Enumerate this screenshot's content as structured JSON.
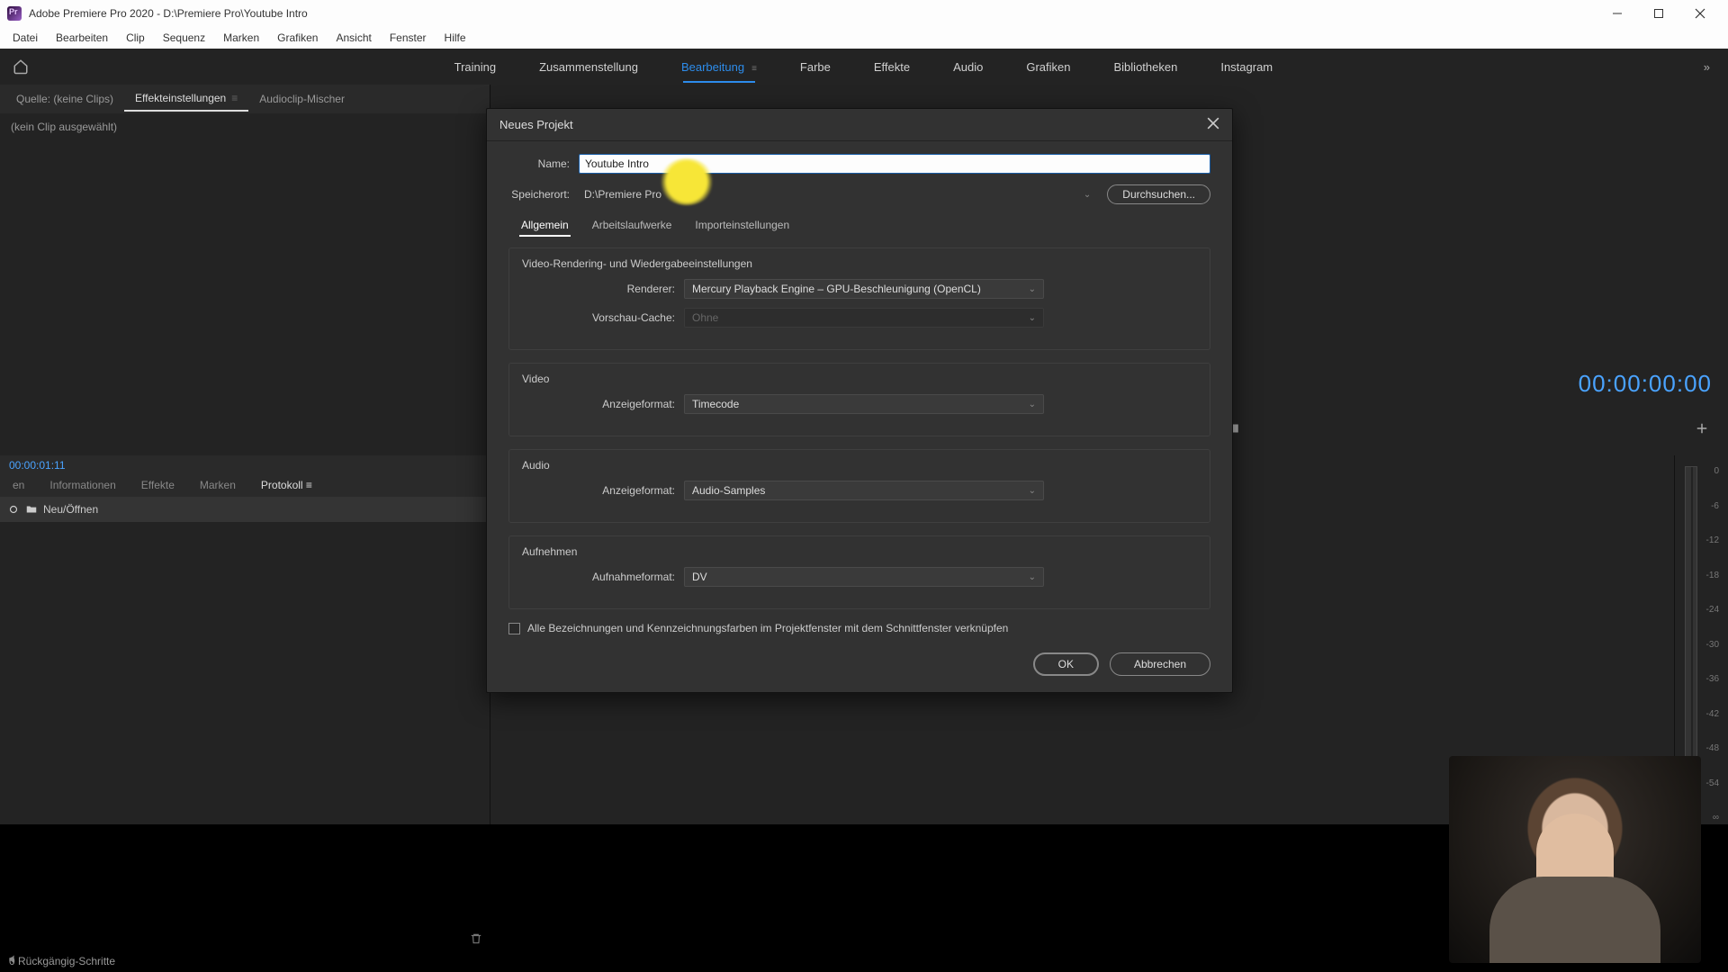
{
  "titlebar": {
    "title": "Adobe Premiere Pro 2020 - D:\\Premiere Pro\\Youtube Intro"
  },
  "menubar": {
    "items": [
      "Datei",
      "Bearbeiten",
      "Clip",
      "Sequenz",
      "Marken",
      "Grafiken",
      "Ansicht",
      "Fenster",
      "Hilfe"
    ]
  },
  "workspaces": {
    "items": [
      "Training",
      "Zusammenstellung",
      "Bearbeitung",
      "Farbe",
      "Effekte",
      "Audio",
      "Grafiken",
      "Bibliotheken",
      "Instagram"
    ],
    "active_index": 2,
    "overflow": "»"
  },
  "source_panel": {
    "tabs": [
      "Quelle: (keine Clips)",
      "Effekteinstellungen",
      "Audioclip-Mischer"
    ],
    "active_index": 1,
    "no_clip": "(kein Clip ausgewählt)"
  },
  "program_panel": {
    "timecode": "00:00:00:00"
  },
  "project_panel": {
    "timecode": "00:00:01:11",
    "tabs": [
      "en",
      "Informationen",
      "Effekte",
      "Marken",
      "Protokoll"
    ],
    "active_index": 4,
    "bin": "Neu/Öffnen"
  },
  "statusbar": {
    "undo": "0 Rückgängig-Schritte"
  },
  "meter": {
    "marks": [
      "0",
      "-6",
      "-12",
      "-18",
      "-24",
      "-30",
      "-36",
      "-42",
      "-48",
      "-54",
      "∞"
    ]
  },
  "dialog": {
    "title": "Neues Projekt",
    "name_label": "Name:",
    "name_value": "Youtube Intro",
    "location_label": "Speicherort:",
    "location_value": "D:\\Premiere Pro",
    "browse": "Durchsuchen...",
    "tabs": [
      "Allgemein",
      "Arbeitslaufwerke",
      "Importeinstellungen"
    ],
    "active_tab": 0,
    "groups": {
      "render": {
        "title": "Video-Rendering- und Wiedergabeeinstellungen",
        "renderer_label": "Renderer:",
        "renderer_value": "Mercury Playback Engine – GPU-Beschleunigung (OpenCL)",
        "cache_label": "Vorschau-Cache:",
        "cache_value": "Ohne"
      },
      "video": {
        "title": "Video",
        "format_label": "Anzeigeformat:",
        "format_value": "Timecode"
      },
      "audio": {
        "title": "Audio",
        "format_label": "Anzeigeformat:",
        "format_value": "Audio-Samples"
      },
      "capture": {
        "title": "Aufnehmen",
        "format_label": "Aufnahmeformat:",
        "format_value": "DV"
      }
    },
    "link_colors": "Alle Bezeichnungen und Kennzeichnungsfarben im Projektfenster mit dem Schnittfenster verknüpfen",
    "ok": "OK",
    "cancel": "Abbrechen"
  }
}
